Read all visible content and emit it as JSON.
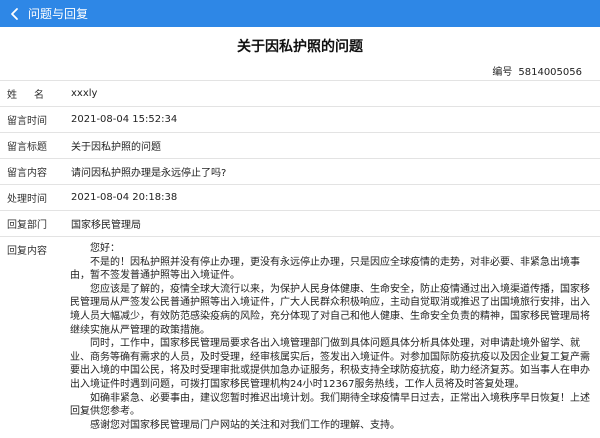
{
  "header": {
    "title": "问题与回复",
    "back_icon": "chevron-left-icon"
  },
  "question": {
    "title": "关于因私护照的问题",
    "number_label": "编号",
    "number": "5814005056"
  },
  "fields": [
    {
      "label": "姓名",
      "value": "xxxly"
    },
    {
      "label": "留言时间",
      "value": "2021-08-04 15:52:34"
    },
    {
      "label": "留言标题",
      "value": "关于因私护照的问题"
    },
    {
      "label": "留言内容",
      "value": "请问因私护照办理是永远停止了吗?"
    },
    {
      "label": "处理时间",
      "value": "2021-08-04 20:18:38"
    },
    {
      "label": "回复部门",
      "value": "国家移民管理局"
    }
  ],
  "reply": {
    "label": "回复内容",
    "paragraphs": [
      "您好：",
      "不是的！因私护照并没有停止办理，更没有永远停止办理，只是因应全球疫情的走势，对非必要、非紧急出境事由，暂不签发普通护照等出入境证件。",
      "您应该是了解的，疫情全球大流行以来，为保护人民身体健康、生命安全，防止疫情通过出入境渠道传播，国家移民管理局从严签发公民普通护照等出入境证件，广大人民群众积极响应，主动自觉取消或推迟了出国境旅行安排，出入境人员大幅减少，有效防范感染疫病的风险，充分体现了对自己和他人健康、生命安全负责的精神，国家移民管理局将继续实施从严管理的政策措施。",
      "同时，工作中，国家移民管理局要求各出入境管理部门做到具体问题具体分析具体处理，对申请赴境外留学、就业、商务等确有需求的人员，及时受理，经审核属实后，签发出入境证件。对参加国际防疫抗疫以及因企业复工复产需要出入境的中国公民，将及时受理审批或提供加急办证服务，积极支持全球防疫抗疫，助力经济复苏。如当事人在申办出入境证件时遇到问题，可拨打国家移民管理机构24小时12367服务热线，工作人员将及时答复处理。",
      "如确非紧急、必要事由，建议您暂时推迟出境计划。我们期待全球疫情早日过去，正常出入境秩序早日恢复！上述回复供您参考。",
      "感谢您对国家移民管理局门户网站的关注和对我们工作的理解、支持。"
    ]
  },
  "colors": {
    "header_bg": "#2e87e6",
    "divider": "#e3e3e3"
  }
}
